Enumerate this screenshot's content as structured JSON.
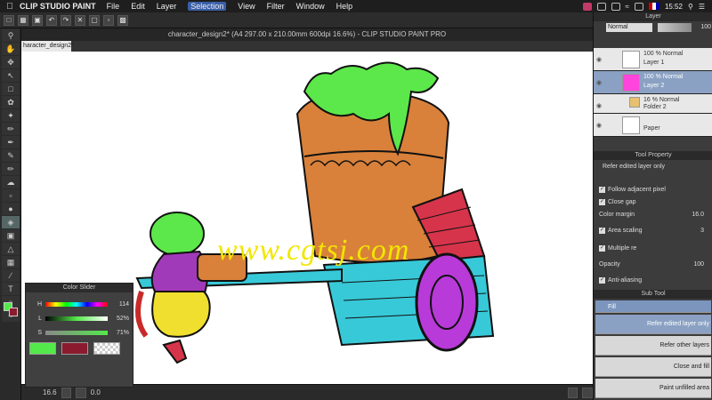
{
  "menubar": {
    "app_name": "CLIP STUDIO PAINT",
    "items": [
      "File",
      "Edit",
      "Layer",
      "Selection",
      "View",
      "Filter",
      "Window",
      "Help"
    ],
    "active_item": "Selection",
    "clock": "15:52"
  },
  "document": {
    "title": "character_design2* (A4 297.00 x 210.00mm 600dpi 16.6%) - CLIP STUDIO PAINT PRO",
    "tab_label": "haracter_design2*"
  },
  "watermark": "www.cgtsj.com",
  "statusbar": {
    "zoom": "16.6",
    "x": "0.0"
  },
  "color_slider": {
    "title": "Color Slider",
    "rows": [
      {
        "label": "H",
        "value": "114"
      },
      {
        "label": "L",
        "value": "52%"
      },
      {
        "label": "S",
        "value": "71%"
      }
    ],
    "main_color": "#53e94a",
    "sub_color": "#8b1a2e"
  },
  "layer_panel": {
    "title": "Layer",
    "blend_mode": "Normal",
    "opacity": "100",
    "layers": [
      {
        "line1": "100 % Normal",
        "line2": "Layer 1",
        "selected": false
      },
      {
        "line1": "100 % Normal",
        "line2": "Layer 2",
        "selected": true
      },
      {
        "line1": "16 % Normal",
        "line2": "Folder 2",
        "selected": false,
        "folder": true
      },
      {
        "line1": "",
        "line2": "Paper",
        "selected": false
      }
    ]
  },
  "tool_property": {
    "title": "Tool Property",
    "subtitle": "Refer edited layer only",
    "options": [
      {
        "label": "Follow adjacent pixel",
        "checked": true
      },
      {
        "label": "Close gap",
        "checked": true
      },
      {
        "label": "Color margin",
        "value": "16.0"
      },
      {
        "label": "Area scaling",
        "value": "3",
        "checked": true
      },
      {
        "label": "Multiple re",
        "checked": true
      },
      {
        "label": "Opacity",
        "value": "100"
      },
      {
        "label": "Anti-aliasing",
        "checked": true
      }
    ]
  },
  "sub_tool": {
    "title": "Sub Tool",
    "group": "Fill",
    "items": [
      "Refer edited layer only",
      "Refer other layers",
      "Close and fill",
      "Paint unfilled area"
    ]
  }
}
